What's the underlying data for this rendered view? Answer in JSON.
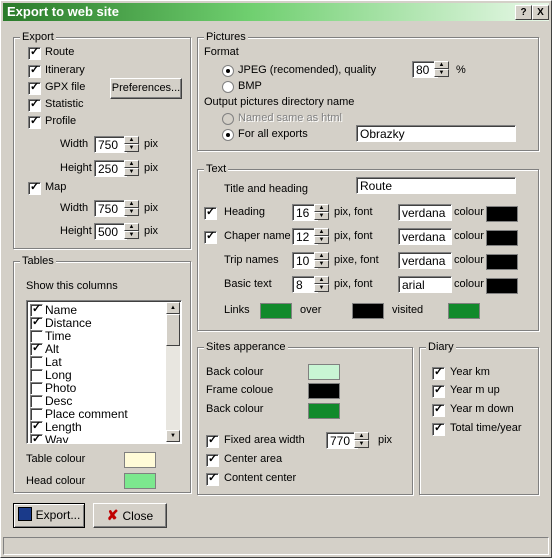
{
  "window": {
    "title": "Export to web site",
    "help_glyph": "?",
    "close_glyph": "X"
  },
  "export": {
    "legend": "Export",
    "route": "Route",
    "itinerary": "Itinerary",
    "gpx": "GPX file",
    "statistic": "Statistic",
    "profile": "Profile",
    "preferences": "Preferences...",
    "profile_width_label": "Width",
    "profile_width": "750",
    "profile_height_label": "Height",
    "profile_height": "250",
    "map": "Map",
    "map_width_label": "Width",
    "map_width": "750",
    "map_height_label": "Height",
    "map_height": "500",
    "unit": "pix"
  },
  "pictures": {
    "legend": "Pictures",
    "format_label": "Format",
    "jpeg": "JPEG (recomended), quality",
    "quality": "80",
    "percent": "%",
    "bmp": "BMP",
    "output_label": "Output pictures directory name",
    "named_same": "Named same as html",
    "for_all": "For all exports",
    "dir_name": "Obrazky"
  },
  "text": {
    "legend": "Text",
    "title_label": "Title and heading",
    "title_value": "Route",
    "heading": "Heading",
    "heading_size": "16",
    "heading_font": "verdana",
    "chapter": "Chaper name",
    "chapter_size": "12",
    "chapter_font": "verdana",
    "trip": "Trip names",
    "trip_size": "10",
    "trip_font": "verdana",
    "basic": "Basic text",
    "basic_size": "8",
    "basic_font": "arial",
    "pix_font": "pix, font",
    "pixe_font": "pixe, font",
    "colour": "colour",
    "links": "Links",
    "over": "over",
    "visited": "visited"
  },
  "tables": {
    "legend": "Tables",
    "show_label": "Show this columns",
    "columns": [
      {
        "label": "Name",
        "checked": true
      },
      {
        "label": "Distance",
        "checked": true
      },
      {
        "label": "Time",
        "checked": false
      },
      {
        "label": "Alt",
        "checked": true
      },
      {
        "label": "Lat",
        "checked": false
      },
      {
        "label": "Long",
        "checked": false
      },
      {
        "label": "Photo",
        "checked": false
      },
      {
        "label": "Desc",
        "checked": false
      },
      {
        "label": "Place comment",
        "checked": false
      },
      {
        "label": "Length",
        "checked": true
      },
      {
        "label": "Way",
        "checked": true
      }
    ],
    "table_colour": "Table colour",
    "head_colour": "Head colour"
  },
  "sites": {
    "legend": "Sites apperance",
    "back_colour_1": "Back colour",
    "frame_colour": "Frame coloue",
    "back_colour_2": "Back colour",
    "fixed_width": "Fixed area width",
    "fixed_width_value": "770",
    "unit": "pix",
    "center_area": "Center area",
    "content_center": "Content center"
  },
  "diary": {
    "legend": "Diary",
    "year_km": "Year km",
    "year_up": "Year m up",
    "year_down": "Year m down",
    "total_time": "Total time/year"
  },
  "buttons": {
    "export": "Export...",
    "close": "Close"
  },
  "colors": {
    "table_colour": "#fffbd8",
    "head_colour": "#7ce88e",
    "site_back": "#c8f5d4",
    "site_frame": "#000000",
    "site_back2": "#128a2c",
    "link": "#128a2c",
    "link_over": "#000000",
    "link_visited": "#128a2c",
    "font_colour": "#000000"
  }
}
